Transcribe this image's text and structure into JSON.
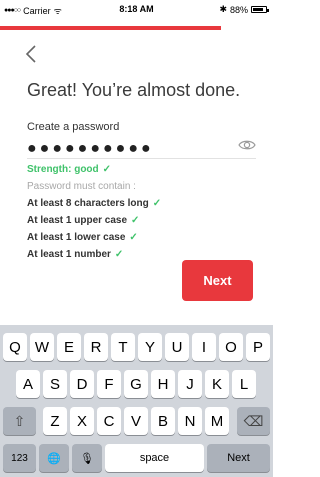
{
  "status_bar": {
    "signal": "●●●○○",
    "carrier": "Carrier",
    "wifi": "ᯤ",
    "time": "8:18 AM",
    "bluetooth": "✱",
    "battery": "88%"
  },
  "progress": {
    "fraction": 0.81
  },
  "header": {
    "back_icon": "chevron-left-icon",
    "title": "Great! You’re almost done."
  },
  "password": {
    "label": "Create a password",
    "value_mask": "●●●●●●●●●●",
    "eye_icon": "eye-icon",
    "strength": "Strength: good",
    "must_contain": "Password must contain :",
    "requirements": [
      "At least 8 characters long",
      "At least 1 upper case",
      "At least 1 lower case",
      "At least 1 number"
    ]
  },
  "next_button": {
    "label": "Next"
  },
  "colors": {
    "accent": "#e8383d",
    "success": "#3fc26a",
    "keyboard_bg": "#d1d5db"
  },
  "keyboard": {
    "row1": [
      "Q",
      "W",
      "E",
      "R",
      "T",
      "Y",
      "U",
      "I",
      "O",
      "P"
    ],
    "row2": [
      "A",
      "S",
      "D",
      "F",
      "G",
      "H",
      "J",
      "K",
      "L"
    ],
    "row3": [
      "Z",
      "X",
      "C",
      "V",
      "B",
      "N",
      "M"
    ],
    "shift": "⇧",
    "delete": "⌫",
    "numbers": "123",
    "globe": "🌐",
    "mic": "🎙",
    "space": "space",
    "return": "Next"
  }
}
